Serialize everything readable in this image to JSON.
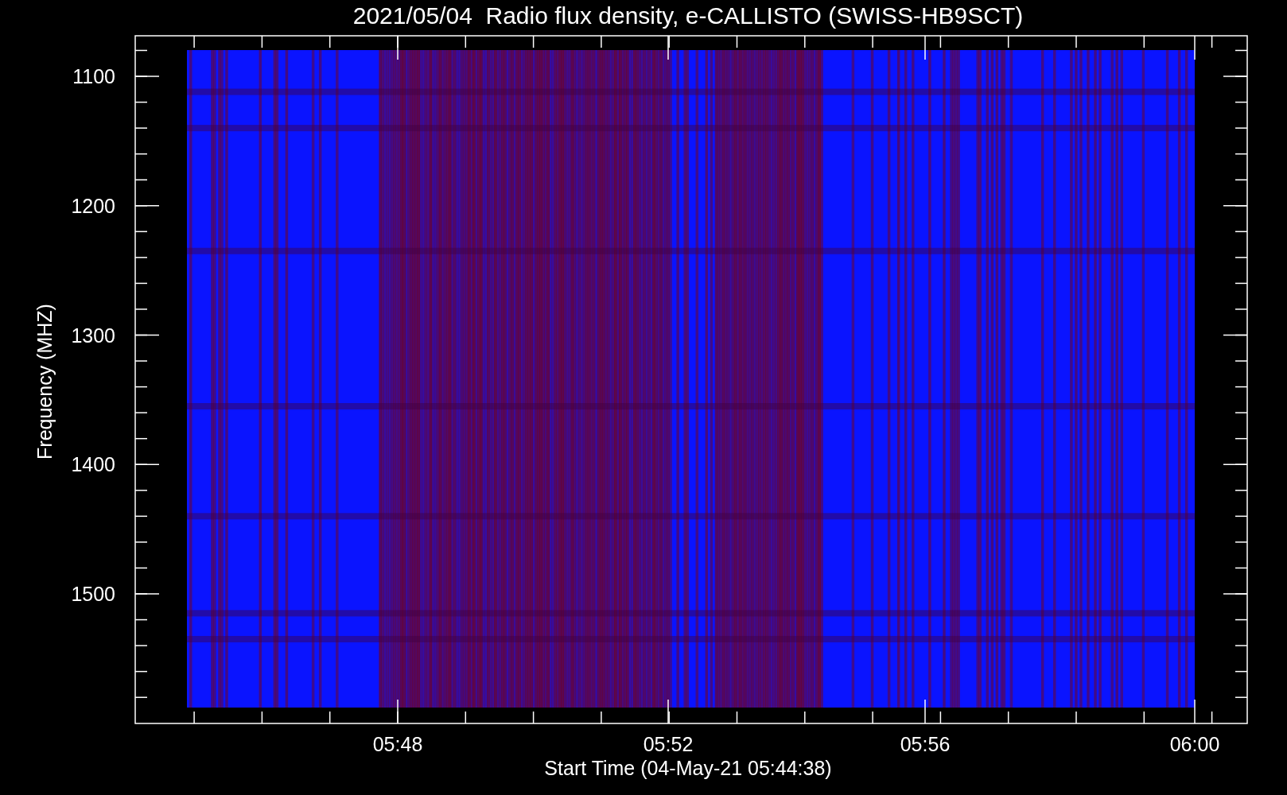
{
  "title": "2021/05/04  Radio flux density, e-CALLISTO (SWISS-HB9SCT)",
  "y_axis": {
    "label": "Frequency (MHZ)",
    "ticks": [
      "1100",
      "1200",
      "1300",
      "1400",
      "1500"
    ]
  },
  "x_axis": {
    "label": "Start Time (04-May-21 05:44:38)",
    "ticks": [
      "05:48",
      "05:52",
      "05:56",
      "06:00"
    ]
  }
}
